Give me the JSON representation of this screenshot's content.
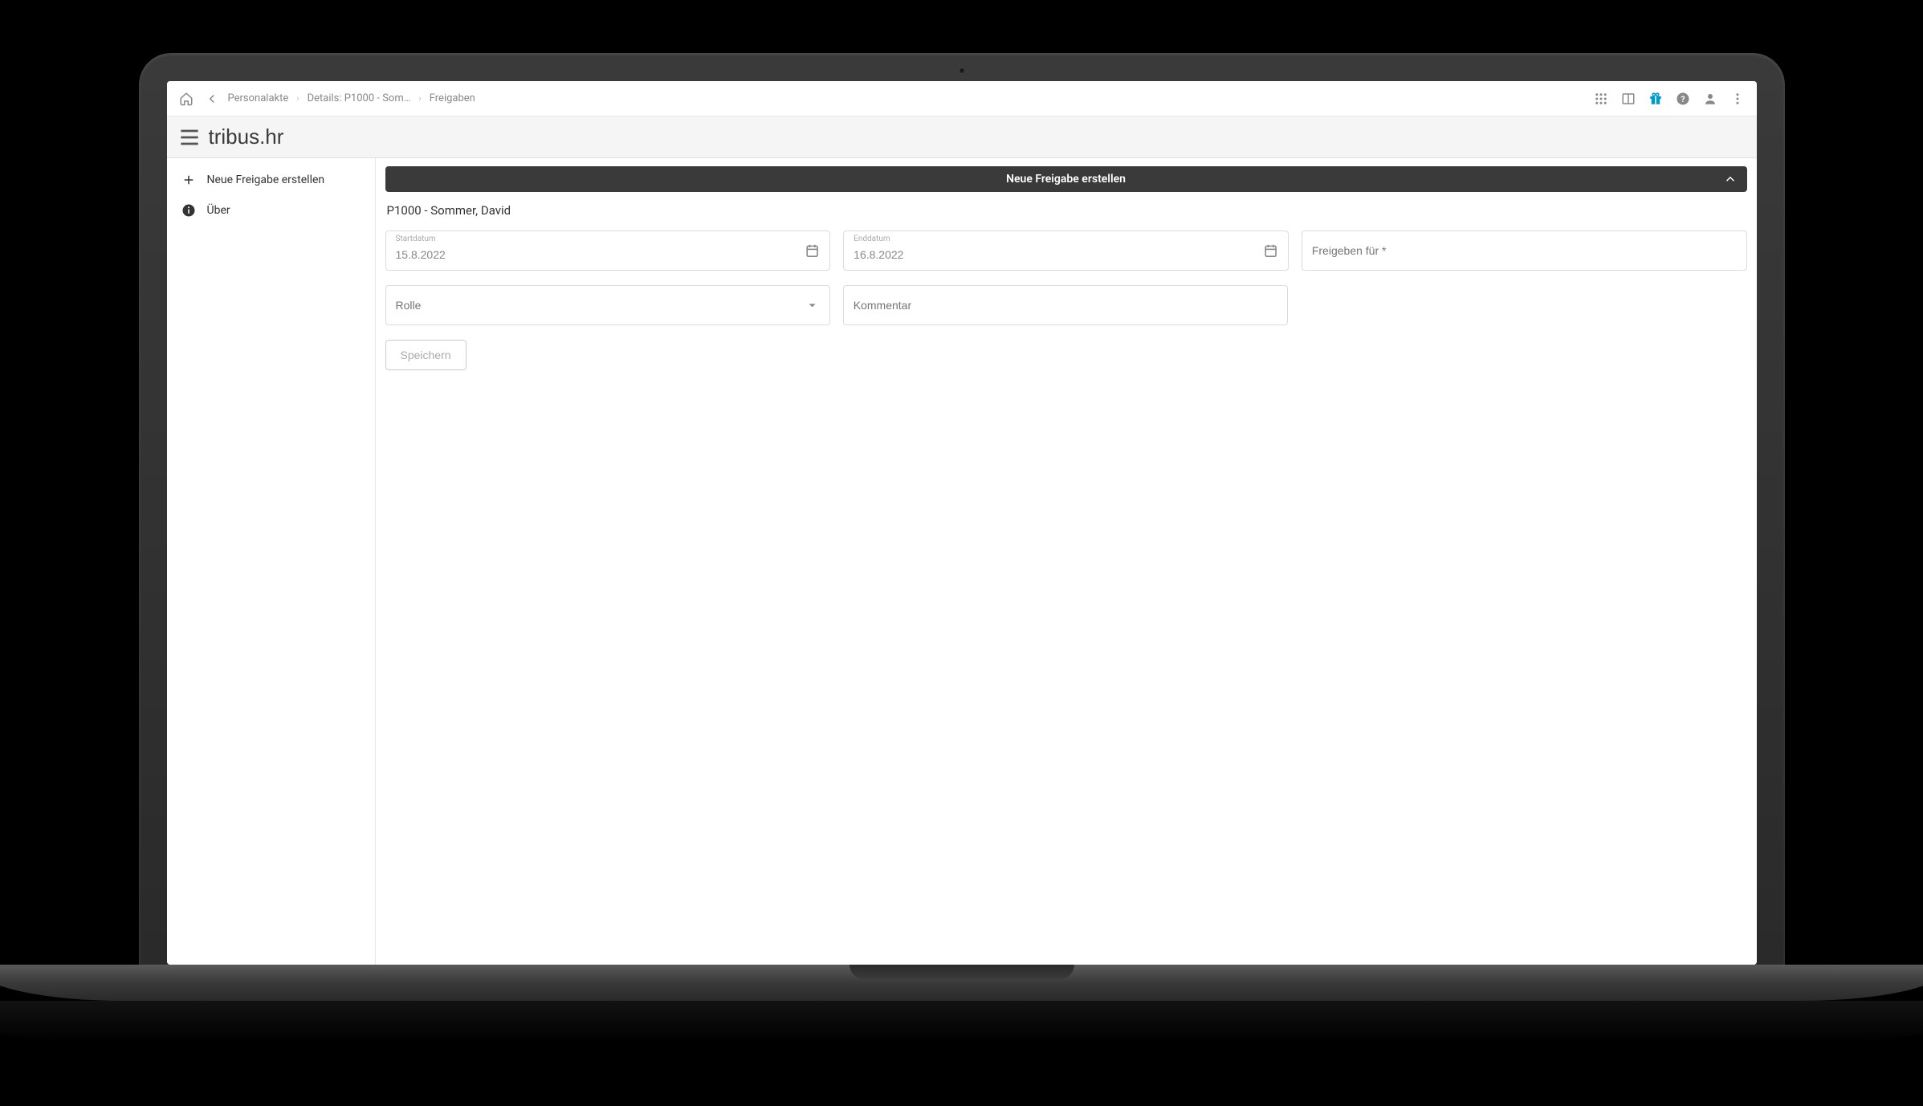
{
  "breadcrumbs": {
    "items": [
      "Personalakte",
      "Details: P1000 - Som…",
      "Freigaben"
    ]
  },
  "brand": {
    "name": "tribus.hr"
  },
  "sidebar": {
    "items": [
      {
        "label": "Neue Freigabe erstellen"
      },
      {
        "label": "Über"
      }
    ]
  },
  "panel": {
    "title": "Neue Freigabe erstellen",
    "record": "P1000 - Sommer, David",
    "fields": {
      "start": {
        "label": "Startdatum",
        "value": "15.8.2022"
      },
      "end": {
        "label": "Enddatum",
        "value": "16.8.2022"
      },
      "release_for": {
        "placeholder": "Freigeben für *"
      },
      "role": {
        "placeholder": "Rolle"
      },
      "comment": {
        "placeholder": "Kommentar"
      }
    },
    "save_label": "Speichern"
  }
}
